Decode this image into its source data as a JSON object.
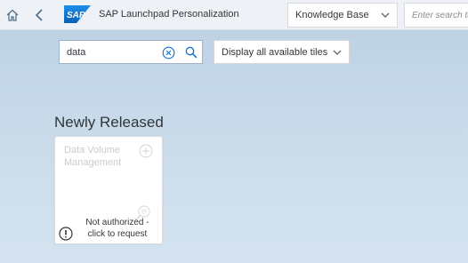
{
  "shell": {
    "logo_text": "SAP",
    "title": "SAP Launchpad Personalization",
    "source_select": {
      "value": "Knowledge Base"
    },
    "search": {
      "placeholder": "Enter search te"
    }
  },
  "filter": {
    "input_value": "data",
    "tiles_select": {
      "value": "Display all available tiles"
    }
  },
  "groups": [
    {
      "title": "Newly Released",
      "tiles": [
        {
          "title": "Data Volume Management",
          "status_line1": "Not authorized -",
          "status_line2": "click to request"
        }
      ]
    }
  ],
  "colors": {
    "background_top": "#b9cfe2",
    "shell_bg": "#eef2f6",
    "sap_blue": "#0a6ed1",
    "text": "#32363a",
    "disabled_text": "#c8ccd0"
  }
}
